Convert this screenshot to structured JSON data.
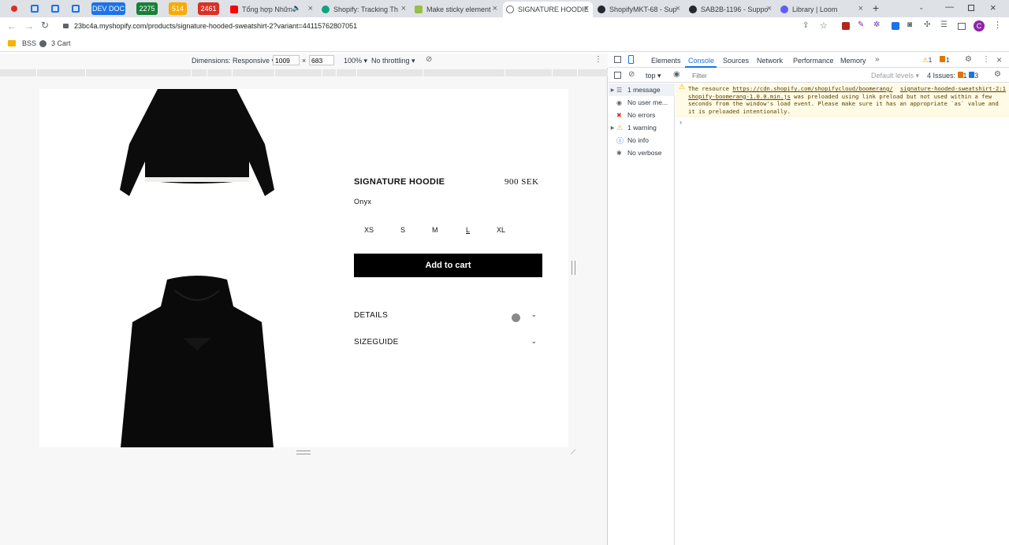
{
  "browser": {
    "pinned": [
      {
        "label": "DEV DOC",
        "color": "#1a73e8"
      },
      {
        "label": "2275",
        "color": "#188038"
      },
      {
        "label": "514",
        "color": "#f9ab00"
      },
      {
        "label": "2461",
        "color": "#d93025"
      }
    ],
    "tabs": [
      {
        "title": "Tổng hợp Nhữn",
        "icon": "youtube-icon"
      },
      {
        "title": "Shopify: Tracking Th",
        "icon": "chatgpt-icon"
      },
      {
        "title": "Make sticky element",
        "icon": "shopify-icon"
      },
      {
        "title": "SIGNATURE HOODIE",
        "icon": "globe-icon",
        "active": true
      },
      {
        "title": "ShopifyMKT-68 - Sup",
        "icon": "github-icon"
      },
      {
        "title": "SAB2B-1196 - Suppo",
        "icon": "github-icon"
      },
      {
        "title": "Library | Loom",
        "icon": "loom-icon"
      }
    ],
    "url": "23bc4a.myshopify.com/products/signature-hooded-sweatshirt-2?variant=44115762807051",
    "bookmarks": [
      {
        "label": "BSS"
      },
      {
        "label": "3 Cart"
      }
    ],
    "profile_initial": "C"
  },
  "device_toolbar": {
    "dimensions_label": "Dimensions: Responsive",
    "width": "1009",
    "height": "683",
    "times": "×",
    "zoom": "100%",
    "throttling": "No throttling"
  },
  "product": {
    "title": "SIGNATURE HOODIE",
    "price": "900 SEK",
    "color": "Onyx",
    "sizes": [
      "XS",
      "S",
      "M",
      "L",
      "XL"
    ],
    "add_to_cart": "Add to cart",
    "accordions": [
      {
        "label": "DETAILS"
      },
      {
        "label": "SIZEGUIDE"
      }
    ]
  },
  "devtools": {
    "tabs": [
      "Elements",
      "Console",
      "Sources",
      "Network",
      "Performance",
      "Memory"
    ],
    "active_tab": "Console",
    "warnings_count": "1",
    "errors_count": "1",
    "context": "top",
    "filter_placeholder": "Filter",
    "levels": "Default levels",
    "issues_label": "4 Issues:",
    "issues_warn": "1",
    "issues_info": "3",
    "sidebar": [
      {
        "label": "1 message",
        "icon": "list-icon"
      },
      {
        "label": "No user me...",
        "icon": "user-icon"
      },
      {
        "label": "No errors",
        "icon": "error-icon"
      },
      {
        "label": "1 warning",
        "icon": "warning-icon"
      },
      {
        "label": "No info",
        "icon": "info-icon"
      },
      {
        "label": "No verbose",
        "icon": "bug-icon"
      }
    ],
    "warning": {
      "prefix": "The resource ",
      "link": "https://cdn.shopify.com/shopifycloud/boomerang/shopify-boomerang-1.0.0.min.js",
      "suffix": " was preloaded using link preload but not used within a few seconds from the window's load event. Please make sure it has an appropriate `as` value and it is preloaded intentionally.",
      "source": "signature-hooded-sweatshirt-2:1"
    }
  }
}
